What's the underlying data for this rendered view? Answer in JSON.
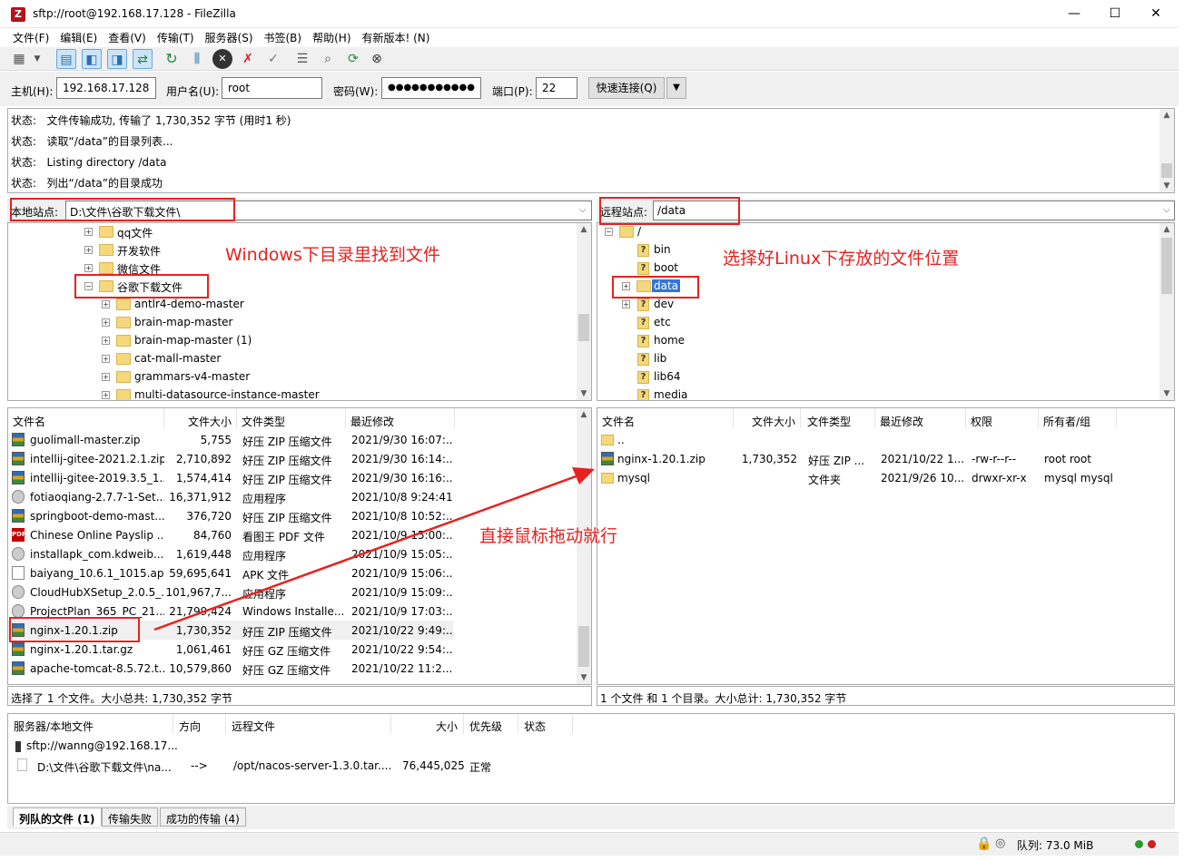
{
  "window": {
    "title": "sftp://root@192.168.17.128 - FileZilla",
    "min": "—",
    "max": "☐",
    "close": "✕"
  },
  "menu": [
    "文件(F)",
    "编辑(E)",
    "查看(V)",
    "传输(T)",
    "服务器(S)",
    "书签(B)",
    "帮助(H)",
    "有新版本! (N)"
  ],
  "quickconnect": {
    "host_label": "主机(H):",
    "host": "192.168.17.128",
    "user_label": "用户名(U):",
    "user": "root",
    "pass_label": "密码(W):",
    "pass": "●●●●●●●●●●●",
    "port_label": "端口(P):",
    "port": "22",
    "button": "快速连接(Q)"
  },
  "log": [
    {
      "k": "状态:",
      "v": "文件传输成功, 传输了 1,730,352 字节 (用时1 秒)"
    },
    {
      "k": "状态:",
      "v": "读取“/data”的目录列表..."
    },
    {
      "k": "状态:",
      "v": "Listing directory /data"
    },
    {
      "k": "状态:",
      "v": "列出“/data”的目录成功"
    }
  ],
  "local": {
    "site_label": "本地站点:",
    "path": "D:\\文件\\谷歌下载文件\\",
    "tree": [
      {
        "name": "qq文件",
        "level": 0,
        "exp": "+"
      },
      {
        "name": "开发软件",
        "level": 0,
        "exp": "+"
      },
      {
        "name": "微信文件",
        "level": 0,
        "exp": "+"
      },
      {
        "name": "谷歌下载文件",
        "level": 0,
        "exp": "−"
      },
      {
        "name": "antlr4-demo-master",
        "level": 1,
        "exp": "+"
      },
      {
        "name": "brain-map-master",
        "level": 1,
        "exp": "+"
      },
      {
        "name": "brain-map-master (1)",
        "level": 1,
        "exp": "+"
      },
      {
        "name": "cat-mall-master",
        "level": 1,
        "exp": "+"
      },
      {
        "name": "grammars-v4-master",
        "level": 1,
        "exp": "+"
      },
      {
        "name": "multi-datasource-instance-master",
        "level": 1,
        "exp": "+"
      }
    ],
    "headers": [
      "文件名",
      "文件大小",
      "文件类型",
      "最近修改"
    ],
    "files": [
      {
        "icon": "zip",
        "name": "guolimall-master.zip",
        "size": "5,755",
        "type": "好压 ZIP 压缩文件",
        "date": "2021/9/30 16:07:..."
      },
      {
        "icon": "zip",
        "name": "intellij-gitee-2021.2.1.zip",
        "size": "2,710,892",
        "type": "好压 ZIP 压缩文件",
        "date": "2021/9/30 16:14:..."
      },
      {
        "icon": "zip",
        "name": "intellij-gitee-2019.3.5_1....",
        "size": "1,574,414",
        "type": "好压 ZIP 压缩文件",
        "date": "2021/9/30 16:16:..."
      },
      {
        "icon": "exe",
        "name": "fotiaoqiang-2.7.7-1-Set...",
        "size": "16,371,912",
        "type": "应用程序",
        "date": "2021/10/8 9:24:41"
      },
      {
        "icon": "zip",
        "name": "springboot-demo-mast...",
        "size": "376,720",
        "type": "好压 ZIP 压缩文件",
        "date": "2021/10/8 10:52:..."
      },
      {
        "icon": "pdf",
        "name": "Chinese Online Payslip ...",
        "size": "84,760",
        "type": "看图王 PDF 文件",
        "date": "2021/10/9 15:00:..."
      },
      {
        "icon": "exe",
        "name": "installapk_com.kdweib...",
        "size": "1,619,448",
        "type": "应用程序",
        "date": "2021/10/9 15:05:..."
      },
      {
        "icon": "doc",
        "name": "baiyang_10.6.1_1015.apk",
        "size": "59,695,641",
        "type": "APK 文件",
        "date": "2021/10/9 15:06:..."
      },
      {
        "icon": "exe",
        "name": "CloudHubXSetup_2.0.5_...",
        "size": "101,967,7...",
        "type": "应用程序",
        "date": "2021/10/9 15:09:..."
      },
      {
        "icon": "exe",
        "name": "ProjectPlan_365_PC_21....",
        "size": "21,799,424",
        "type": "Windows Installe...",
        "date": "2021/10/9 17:03:..."
      },
      {
        "icon": "zip",
        "name": "nginx-1.20.1.zip",
        "size": "1,730,352",
        "type": "好压 ZIP 压缩文件",
        "date": "2021/10/22 9:49:..."
      },
      {
        "icon": "zip",
        "name": "nginx-1.20.1.tar.gz",
        "size": "1,061,461",
        "type": "好压 GZ 压缩文件",
        "date": "2021/10/22 9:54:..."
      },
      {
        "icon": "zip",
        "name": "apache-tomcat-8.5.72.t...",
        "size": "10,579,860",
        "type": "好压 GZ 压缩文件",
        "date": "2021/10/22 11:2..."
      }
    ],
    "status": "选择了 1 个文件。大小总共: 1,730,352 字节"
  },
  "remote": {
    "site_label": "远程站点:",
    "path": "/data",
    "tree": [
      {
        "name": "/",
        "kind": "folder",
        "exp": "−",
        "level": 0
      },
      {
        "name": "bin",
        "kind": "q",
        "level": 1
      },
      {
        "name": "boot",
        "kind": "q",
        "level": 1
      },
      {
        "name": "data",
        "kind": "folder",
        "exp": "+",
        "level": 1,
        "selected": true
      },
      {
        "name": "dev",
        "kind": "q",
        "level": 1,
        "exp": "+"
      },
      {
        "name": "etc",
        "kind": "q",
        "level": 1
      },
      {
        "name": "home",
        "kind": "q",
        "level": 1
      },
      {
        "name": "lib",
        "kind": "q",
        "level": 1
      },
      {
        "name": "lib64",
        "kind": "q",
        "level": 1
      },
      {
        "name": "media",
        "kind": "q",
        "level": 1
      }
    ],
    "headers": [
      "文件名",
      "文件大小",
      "文件类型",
      "最近修改",
      "权限",
      "所有者/组"
    ],
    "files": [
      {
        "icon": "fdr",
        "name": "..",
        "size": "",
        "type": "",
        "date": "",
        "perm": "",
        "owner": ""
      },
      {
        "icon": "zip",
        "name": "nginx-1.20.1.zip",
        "size": "1,730,352",
        "type": "好压 ZIP ...",
        "date": "2021/10/22 1...",
        "perm": "-rw-r--r--",
        "owner": "root root"
      },
      {
        "icon": "fdr",
        "name": "mysql",
        "size": "",
        "type": "文件夹",
        "date": "2021/9/26 10...",
        "perm": "drwxr-xr-x",
        "owner": "mysql mysql"
      }
    ],
    "status": "1 个文件 和 1 个目录。大小总计: 1,730,352 字节"
  },
  "queue": {
    "headers": [
      "服务器/本地文件",
      "方向",
      "远程文件",
      "大小",
      "优先级",
      "状态"
    ],
    "server": "sftp://wanng@192.168.17...",
    "row": {
      "local": "D:\\文件\\谷歌下载文件\\na...",
      "dir": "-->",
      "remote": "/opt/nacos-server-1.3.0.tar....",
      "size": "76,445,025",
      "prio": "正常"
    }
  },
  "tabs": [
    "列队的文件 (1)",
    "传输失败",
    "成功的传输 (4)"
  ],
  "statusbar": {
    "queue": "队列: 73.0 MiB"
  },
  "annotations": {
    "local_note": "Windows下目录里找到文件",
    "remote_note": "选择好Linux下存放的文件位置",
    "drag_note": "直接鼠标拖动就行"
  },
  "colors": {
    "annotation": "#e8211f",
    "selection": "#cce8ff",
    "folder": "#f5d87b"
  }
}
